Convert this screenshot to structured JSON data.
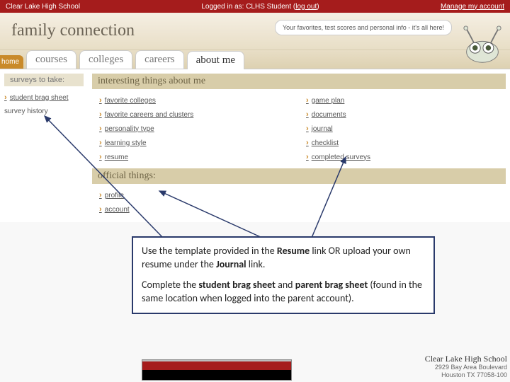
{
  "topbar": {
    "school": "Clear Lake High School",
    "logged_in_prefix": "Logged in as: CLHS Student (",
    "logout": "log out",
    "logged_in_suffix": ")",
    "manage": "Manage my account"
  },
  "header": {
    "brand": "family connection",
    "bubble": "Your favorites, test scores and personal info - it's all here!"
  },
  "tabs": {
    "home": "home",
    "items": [
      "courses",
      "colleges",
      "careers",
      "about me"
    ],
    "active_index": 3
  },
  "sidebar": {
    "head": "surveys to take:",
    "items": [
      "student brag sheet"
    ],
    "history": "survey history"
  },
  "content": {
    "head1": "interesting things about me",
    "col1": [
      "favorite colleges",
      "favorite careers and clusters",
      "personality type",
      "learning style",
      "resume"
    ],
    "col2": [
      "game plan",
      "documents",
      "journal",
      "checklist",
      "completed surveys"
    ],
    "head2": "official things:",
    "off": [
      "profile",
      "account"
    ]
  },
  "callout": {
    "p1a": "Use the template provided in the ",
    "p1b": "Resume",
    "p1c": " link OR upload your own resume under the ",
    "p1d": "Journal",
    "p1e": " link.",
    "p2a": "Complete the ",
    "p2b": "student brag sheet",
    "p2c": " and ",
    "p2d": "parent brag sheet",
    "p2e": " (found in the same location when logged into the parent account)."
  },
  "footer": {
    "school": "Clear Lake High School",
    "addr1": "2929 Bay Area Boulevard",
    "addr2": "Houston TX 77058-100"
  }
}
